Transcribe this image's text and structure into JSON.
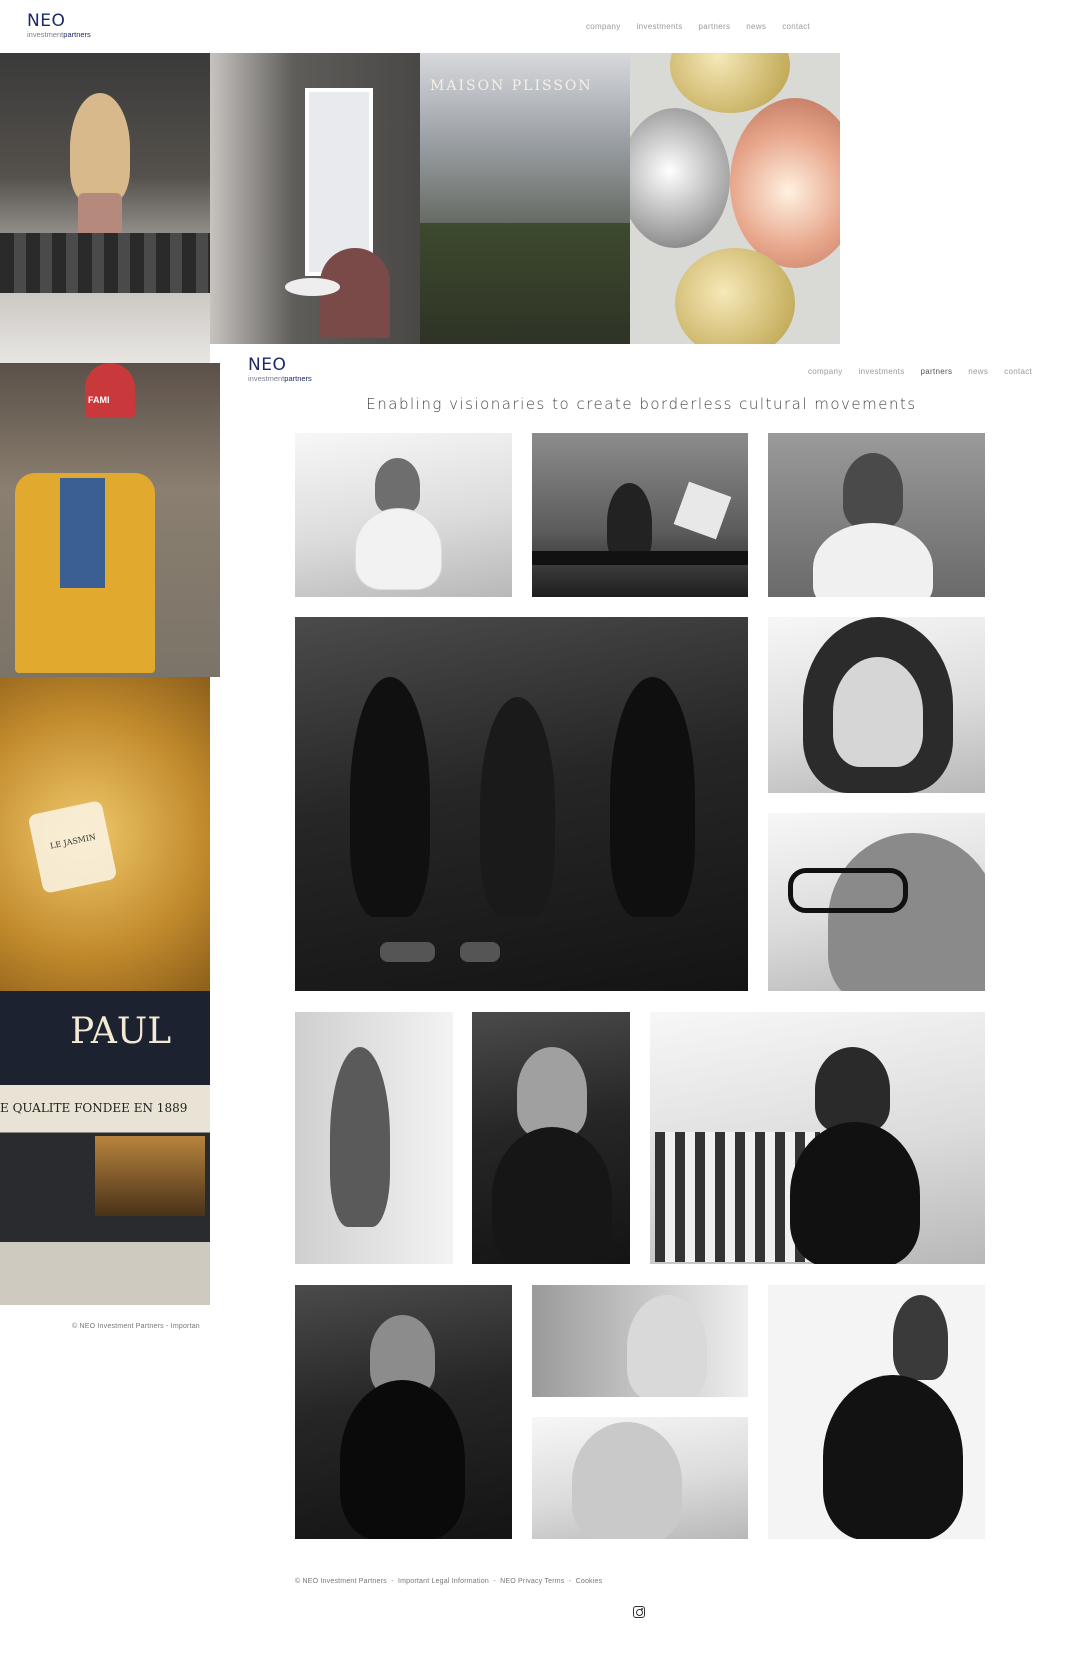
{
  "brand": {
    "name": "NEO",
    "sub_a": "investment",
    "sub_b": "partners"
  },
  "nav_top": [
    "company",
    "investments",
    "partners",
    "news",
    "contact"
  ],
  "nav_overlay": [
    "company",
    "investments",
    "partners",
    "news",
    "contact"
  ],
  "nav_active": "partners",
  "tagline": "Enabling visionaries to create borderless cultural movements",
  "hero_images": {
    "maison_sign": "MAISON PLISSON",
    "paul_sign": "PAUL",
    "paul_sub": "E QUALITE FONDEE EN 1889",
    "famil_hat": "FAMI",
    "perfume_label": "LE JASMIN"
  },
  "footer_left": "© NEO Investment Partners  -  Importan",
  "footer": {
    "copyright": "© NEO Investment Partners",
    "legal": "Important Legal Information",
    "privacy": "NEO Privacy Terms",
    "cookies": "Cookies",
    "sep": "-"
  },
  "icons": {
    "social": "instagram-icon"
  }
}
